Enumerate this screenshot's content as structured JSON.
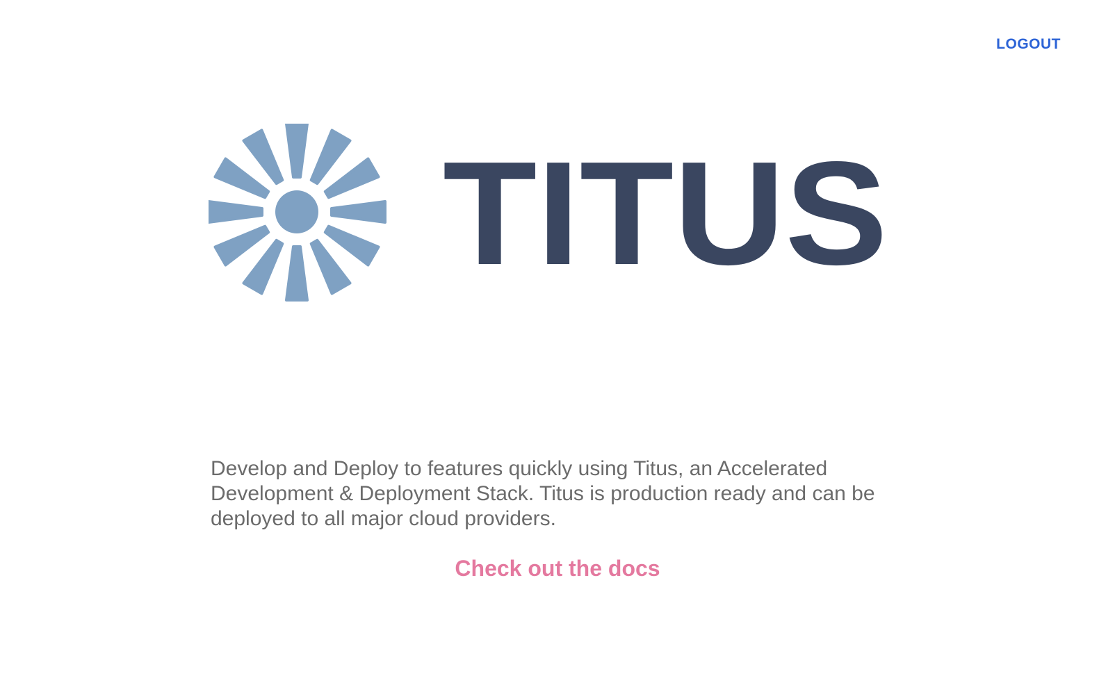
{
  "header": {
    "logout_label": "LOGOUT"
  },
  "brand": {
    "name": "TITUS",
    "icon": "sunburst-logo-icon",
    "icon_color": "#7fa1c3",
    "text_color": "#3a4660"
  },
  "main": {
    "description": "Develop and Deploy to features quickly using Titus, an Accelerated Development & Deployment Stack. Titus is production ready and can be deployed to all major cloud providers.",
    "docs_link_label": "Check out the docs",
    "docs_link_color": "#e4799f",
    "logout_color": "#2c63d6"
  }
}
